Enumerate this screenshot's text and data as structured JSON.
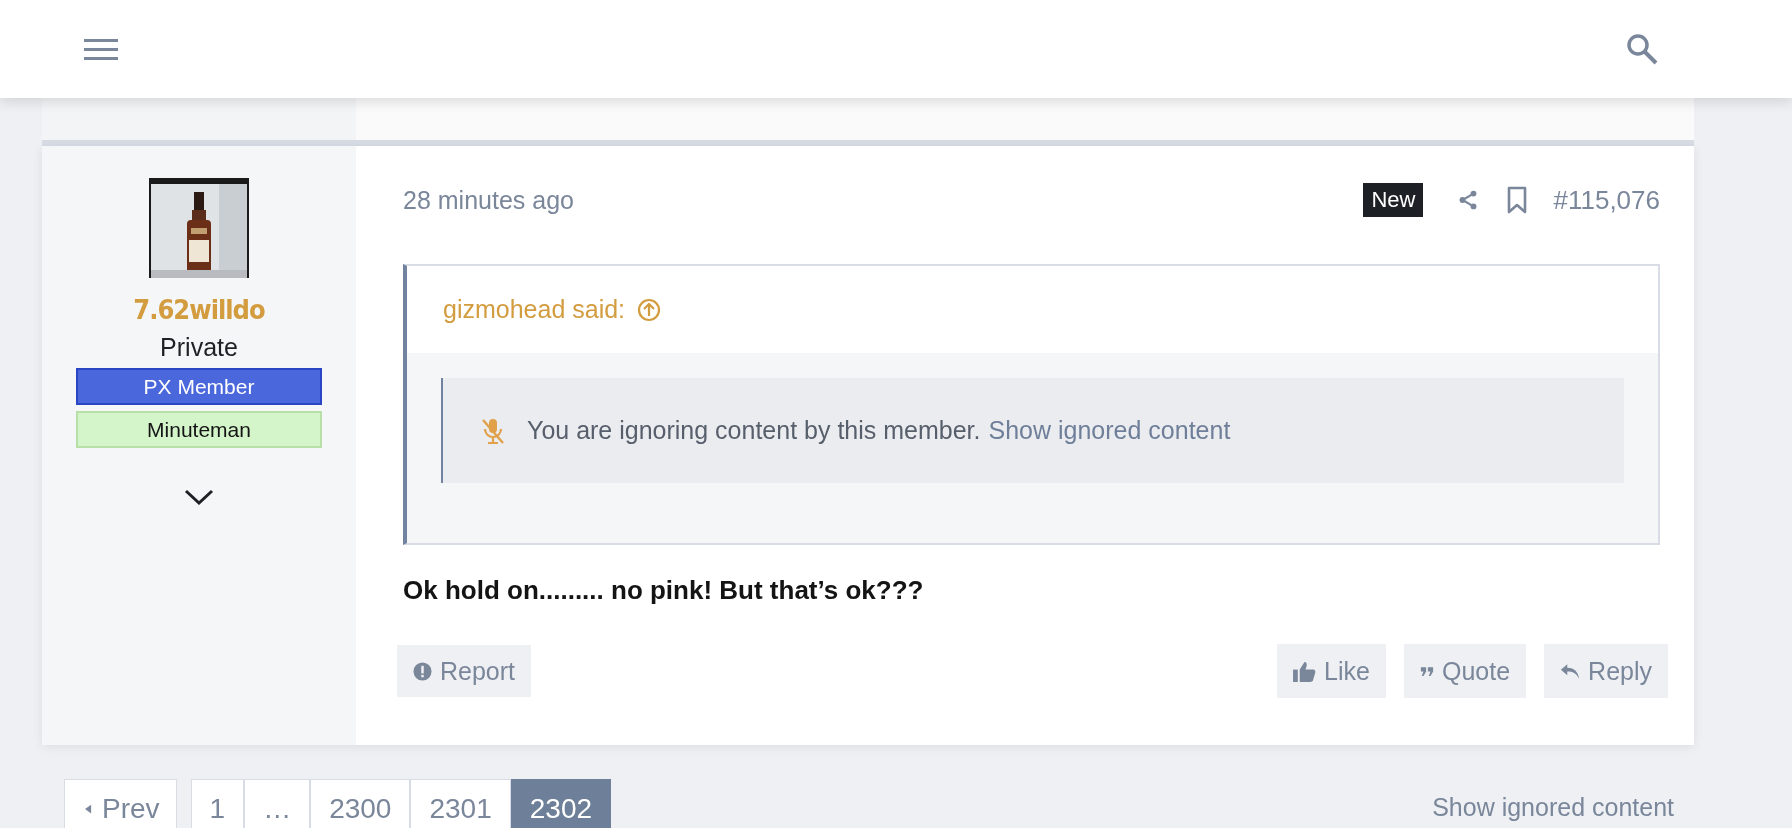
{
  "post": {
    "time": "28 minutes ago",
    "badge": "New",
    "number": "#115,076",
    "author": {
      "name": "7.62willdo",
      "title": "Private",
      "banners": [
        {
          "label": "PX Member",
          "color": "#4a67dc"
        },
        {
          "label": "Minuteman",
          "color": "#d4f5c9"
        }
      ]
    },
    "quote": {
      "author": "gizmohead said:",
      "ignored_text": "You are ignoring content by this member.",
      "show_link": "Show ignored content"
    },
    "message": "Ok hold on......... no pink! But that’s ok???",
    "actions": [
      {
        "label": "Report",
        "kind": "report"
      },
      {
        "label": "Like",
        "kind": "like"
      },
      {
        "label": "Quote",
        "kind": "quote"
      },
      {
        "label": "Reply",
        "kind": "reply"
      }
    ]
  },
  "pagination": {
    "prev": "Prev",
    "pages": [
      {
        "label": "1",
        "selected": false
      },
      {
        "label": "…",
        "selected": false
      },
      {
        "label": "2300",
        "selected": false
      },
      {
        "label": "2301",
        "selected": false
      },
      {
        "label": "2302",
        "selected": true
      }
    ]
  },
  "footer_link": "Show ignored content"
}
